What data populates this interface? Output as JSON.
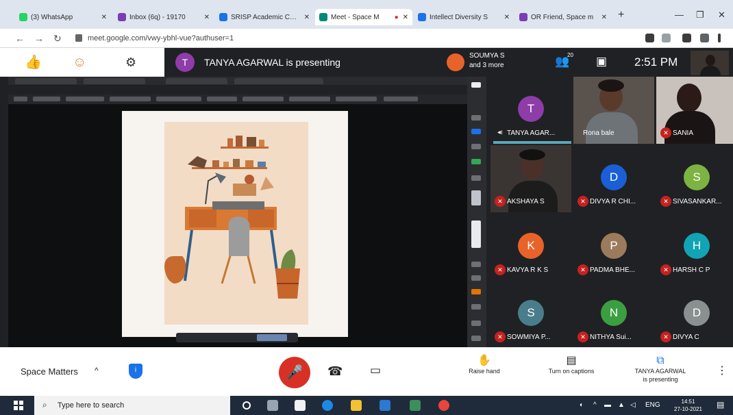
{
  "browser": {
    "tabs": [
      {
        "label": "(3) WhatsApp",
        "color": "#25d366"
      },
      {
        "label": "Inbox (6q) - 19170",
        "color": "#7a3db8"
      },
      {
        "label": "SRISP Academic Cells",
        "color": "#1a73e8"
      },
      {
        "label": "Meet - Space M",
        "color": "#00897b"
      },
      {
        "label": "Intellect Diversity S",
        "color": "#1a73e8"
      },
      {
        "label": "OR Friend, Space m",
        "color": "#7a3db8"
      }
    ],
    "new_tab": "+",
    "url": "meet.google.com/vwy-ybhl-vue?authuser=1"
  },
  "meet_top": {
    "presenter_initial": "T",
    "presenting_text": "TANYA AGARWAL is presenting",
    "others_line1": "SOUMYA S",
    "others_line2": "and 3 more",
    "people_count": "20",
    "time": "2:51 PM"
  },
  "participants": [
    {
      "name": "TANYA AGAR...",
      "initial": "T",
      "color": "#8e3ca8",
      "speaking": true
    },
    {
      "name": "Rona bale",
      "video": true
    },
    {
      "name": "SANIA",
      "video": true,
      "muted": true
    },
    {
      "name": "AKSHAYA S",
      "video": true,
      "muted": true
    },
    {
      "name": "DIVYA R CHI...",
      "initial": "D",
      "color": "#1a5fd6",
      "muted": true
    },
    {
      "name": "SIVASANKAR...",
      "initial": "S",
      "color": "#7cb342",
      "muted": true
    },
    {
      "name": "KAVYA R K S",
      "initial": "K",
      "color": "#e8632a",
      "muted": true
    },
    {
      "name": "PADMA BHE...",
      "initial": "P",
      "color": "#9c7b5c",
      "muted": true
    },
    {
      "name": "HARSH C P",
      "initial": "H",
      "color": "#12a4b4",
      "muted": true
    },
    {
      "name": "SOWMIYA P...",
      "initial": "S",
      "color": "#4a7d8c",
      "muted": true
    },
    {
      "name": "NITHYA Sui...",
      "initial": "N",
      "color": "#3b9f42",
      "muted": true
    },
    {
      "name": "DIVYA C",
      "initial": "D",
      "color": "#8a9090",
      "muted": true
    }
  ],
  "controls": {
    "meeting_name": "Space Matters",
    "caret": "^",
    "raise_hand": "Raise hand",
    "captions": "Turn on captions",
    "presenting_line1": "TANYA AGARWAL",
    "presenting_line2": "is presenting"
  },
  "taskbar": {
    "search_placeholder": "Type here to search",
    "tray_text": "ENG",
    "time": "14:51",
    "date": "27-10-2021"
  }
}
